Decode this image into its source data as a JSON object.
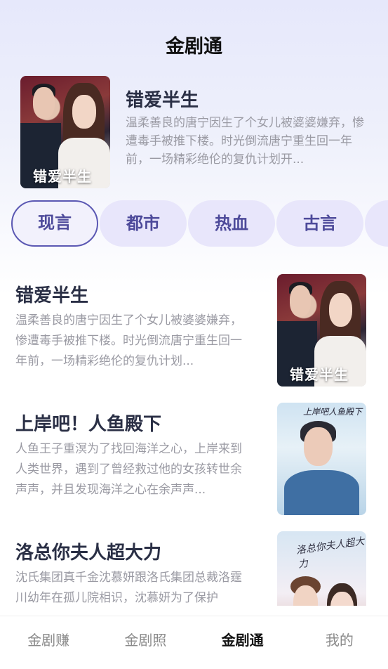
{
  "header": {
    "title": "金剧通"
  },
  "featured": {
    "title": "错爱半生",
    "description": "温柔善良的唐宁因生了个女儿被婆婆嫌弃，惨遭毒手被推下楼。时光倒流唐宁重生回一年前，一场精彩绝伦的复仇计划开...",
    "cover_text": "错爱半生"
  },
  "categories": [
    "现言",
    "都市",
    "热血",
    "古言"
  ],
  "list": [
    {
      "title": "错爱半生",
      "description": "温柔善良的唐宁因生了个女儿被婆婆嫌弃，惨遭毒手被推下楼。时光倒流唐宁重生回一年前，一场精彩绝伦的复仇计划...",
      "cover_text": "错爱半生"
    },
    {
      "title": "上岸吧！人鱼殿下",
      "description": "人鱼王子重溟为了找回海洋之心，上岸来到人类世界，遇到了曾经救过他的女孩转世余声声，并且发现海洋之心在余声声...",
      "cover_text": "上岸吧人鱼殿下"
    },
    {
      "title": "洛总你夫人超大力",
      "description": "沈氏集团真千金沈慕妍跟洛氏集团总裁洛霆川幼年在孤儿院相识，沈慕妍为了保护",
      "cover_text": "洛总你夫人超大力"
    }
  ],
  "tabbar": [
    "金剧赚",
    "金剧照",
    "金剧通",
    "我的"
  ]
}
